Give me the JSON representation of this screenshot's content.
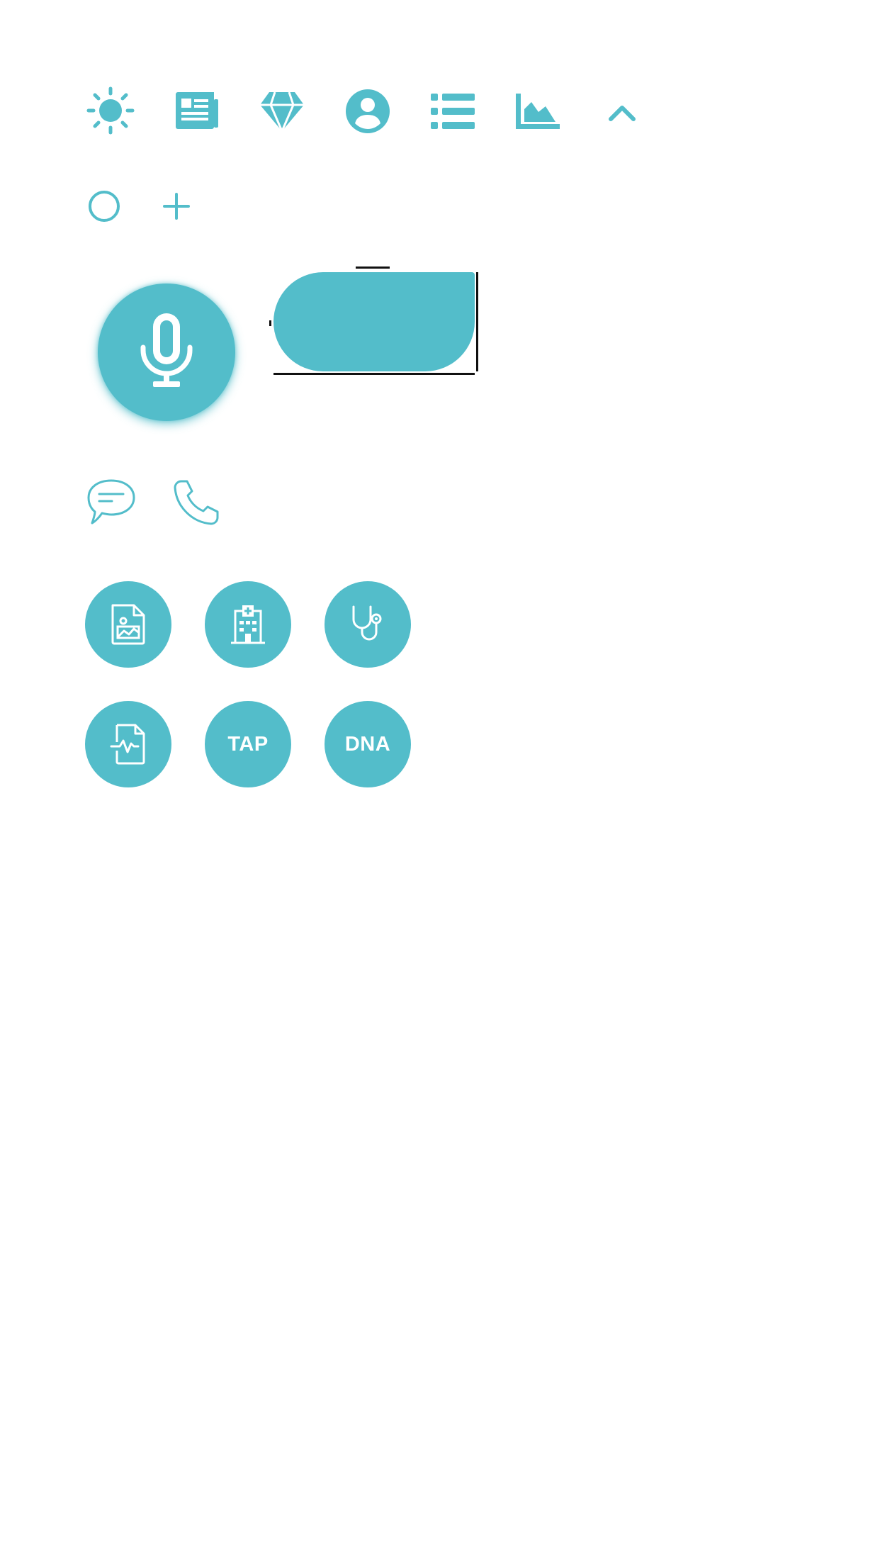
{
  "theme": {
    "accent": "#53bdca",
    "background": "#ffffff",
    "icon_on_accent": "#ffffff"
  },
  "top_icons": [
    "sun-icon",
    "newspaper-icon",
    "diamond-icon",
    "user-circle-icon",
    "list-icon",
    "area-chart-icon",
    "chevron-up-icon"
  ],
  "second_row_icons": [
    "circle-outline-icon",
    "plus-icon"
  ],
  "voice": {
    "icon": "microphone-icon"
  },
  "contact_icons": [
    "chat-bubble-icon",
    "phone-icon"
  ],
  "grid_buttons": [
    {
      "icon": "image-document-icon"
    },
    {
      "icon": "hospital-icon"
    },
    {
      "icon": "stethoscope-icon"
    },
    {
      "icon": "pulse-document-icon"
    },
    {
      "label": "TAP"
    },
    {
      "label": "DNA"
    }
  ]
}
